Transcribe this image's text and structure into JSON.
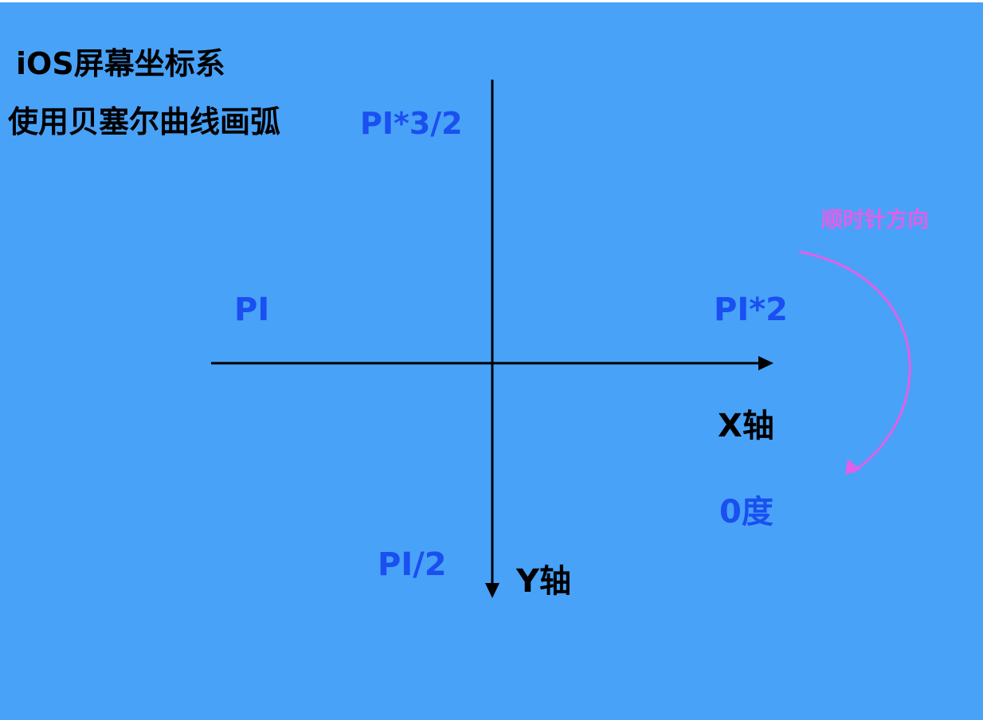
{
  "title": "iOS屏幕坐标系",
  "subtitle": "使用贝塞尔曲线画弧",
  "angles": {
    "three_half_pi": "PI*3/2",
    "pi": "PI",
    "two_pi": "PI*2",
    "zero": "0度",
    "half_pi": "PI/2"
  },
  "axes": {
    "x_label": "X轴",
    "y_label": "Y轴"
  },
  "direction": {
    "label": "顺时针方向"
  },
  "colors": {
    "background": "#48a2f8",
    "axis": "#000000",
    "angle_label": "#1a4ff0",
    "direction_arc": "#e25fe9"
  }
}
